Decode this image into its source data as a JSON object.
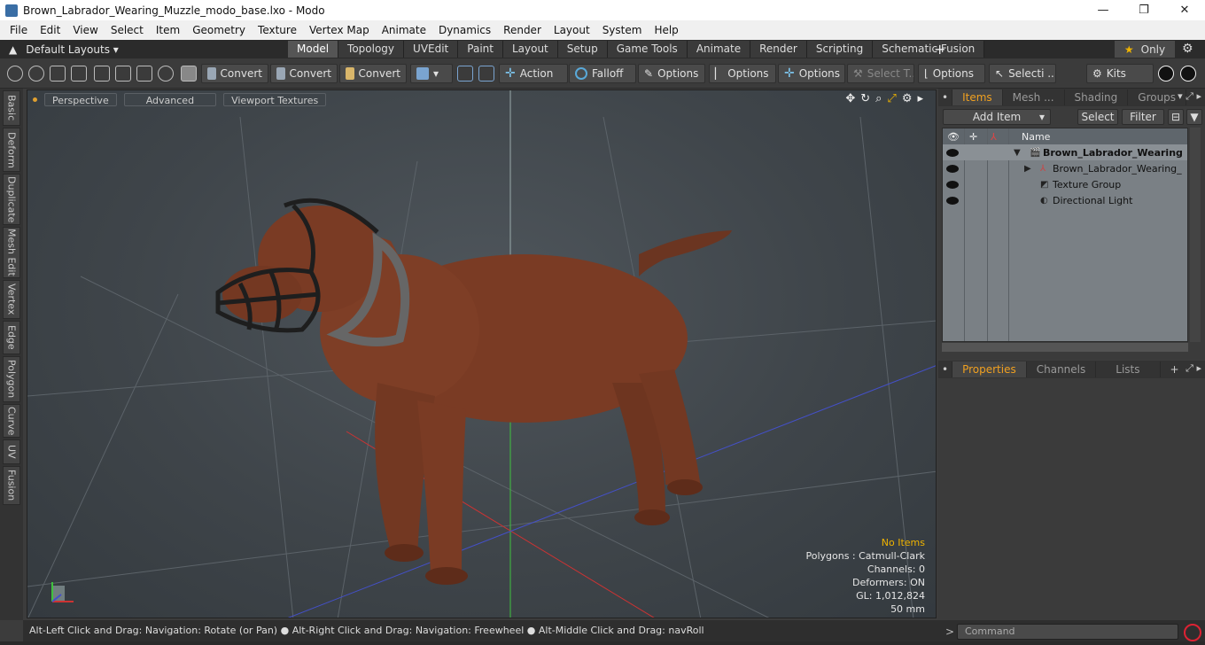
{
  "window": {
    "title": "Brown_Labrador_Wearing_Muzzle_modo_base.lxo - Modo",
    "minimize": "—",
    "maximize": "❐",
    "close": "✕"
  },
  "menu": [
    "File",
    "Edit",
    "View",
    "Select",
    "Item",
    "Geometry",
    "Texture",
    "Vertex Map",
    "Animate",
    "Dynamics",
    "Render",
    "Layout",
    "System",
    "Help"
  ],
  "layouts": {
    "label": "Default Layouts ▾"
  },
  "tabs": [
    "Model",
    "Topology",
    "UVEdit",
    "Paint",
    "Layout",
    "Setup",
    "Game Tools",
    "Animate",
    "Render",
    "Scripting",
    "Schematic Fusion"
  ],
  "active_tab": "Model",
  "only": {
    "label": "Only"
  },
  "toolbar": {
    "convert1": "Convert",
    "convert2": "Convert",
    "convert3": "Convert",
    "action": "Action",
    "falloff": "Falloff",
    "options1": "Options",
    "options2": "Options",
    "options3": "Options",
    "select_t": "Select T...",
    "options4": "Options",
    "selecti": "Selecti ...",
    "kits": "Kits"
  },
  "left_tabs": [
    "Basic",
    "Deform",
    "Duplicate",
    "Mesh Edit",
    "Vertex",
    "Edge",
    "Polygon",
    "Curve",
    "UV",
    "Fusion"
  ],
  "viewport": {
    "tabs": [
      "Perspective",
      "Advanced",
      "Viewport Textures"
    ],
    "stats": {
      "no_items": "No Items",
      "polygons": "Polygons : Catmull-Clark",
      "channels": "Channels: 0",
      "deformers": "Deformers: ON",
      "gl": "GL: 1,012,824",
      "size": "50 mm"
    }
  },
  "status": "Alt-Left Click and Drag: Navigation: Rotate (or Pan) ● Alt-Right Click and Drag: Navigation: Freewheel ● Alt-Middle Click and Drag: navRoll",
  "items_panel": {
    "tabs": [
      "Items",
      "Mesh ...",
      "Shading",
      "Groups"
    ],
    "add_item": "Add Item",
    "select": "Select",
    "filter": "Filter",
    "name_col": "Name",
    "rows": [
      {
        "label": "Brown_Labrador_Wearing ..."
      },
      {
        "label": "Brown_Labrador_Wearing_ ..."
      },
      {
        "label": "Texture Group"
      },
      {
        "label": "Directional Light"
      }
    ]
  },
  "props_panel": {
    "tabs": [
      "Properties",
      "Channels",
      "Lists"
    ]
  },
  "command": {
    "placeholder": "Command"
  }
}
